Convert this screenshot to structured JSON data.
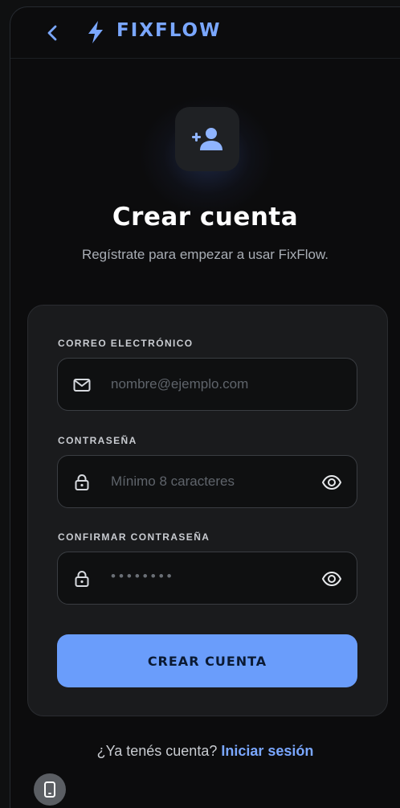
{
  "header": {
    "brand": "FIXFLOW",
    "back_icon": "chevron-left-icon",
    "logo_icon": "bolt-icon",
    "accent": "#7aa7ff"
  },
  "hero": {
    "icon": "person-add-icon",
    "title": "Crear cuenta",
    "subtitle": "Regístrate para empezar a usar FixFlow."
  },
  "form": {
    "email": {
      "label": "CORREO ELECTRÓNICO",
      "placeholder": "nombre@ejemplo.com",
      "icon": "mail-icon"
    },
    "password": {
      "label": "CONTRASEÑA",
      "placeholder": "Mínimo 8 caracteres",
      "icon": "lock-icon",
      "toggle_icon": "eye-icon"
    },
    "confirm": {
      "label": "CONFIRMAR CONTRASEÑA",
      "value": "••••••••",
      "icon": "lock-icon",
      "toggle_icon": "eye-icon"
    },
    "submit_label": "CREAR CUENTA",
    "button_color": "#6a9dfb"
  },
  "footer": {
    "prompt": "¿Ya tenés cuenta?",
    "link": "Iniciar sesión"
  },
  "device_toggle_icon": "phone-icon"
}
